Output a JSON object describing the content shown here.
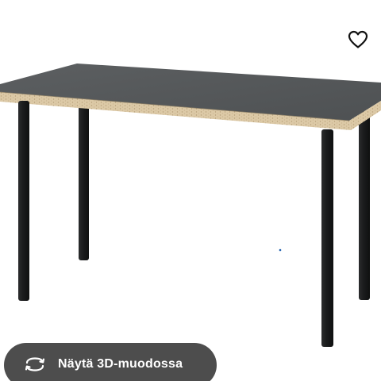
{
  "product": {
    "image_subject": "grey laminated desk with black round legs"
  },
  "favorite": {
    "icon": "heart-icon"
  },
  "view_3d": {
    "label": "Näytä 3D-muodossa",
    "icon": "rotate-3d-icon"
  },
  "colors": {
    "button_background": "#4d4d4d",
    "button_text": "#ffffff",
    "tabletop": "#56595b",
    "tabletop_edge": "#d9c7a5",
    "legs": "#1d1e1f"
  }
}
